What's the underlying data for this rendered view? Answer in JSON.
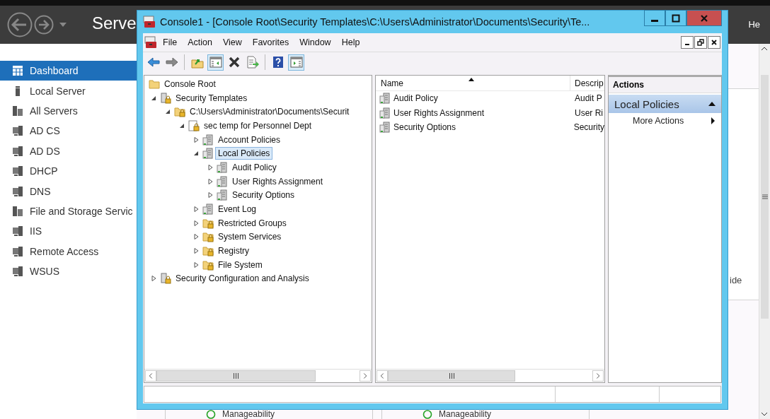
{
  "server_manager": {
    "title": "Serve",
    "user_menu": "He",
    "sidebar": [
      {
        "label": "Dashboard",
        "kind": "dashboard",
        "selected": true
      },
      {
        "label": "Local Server",
        "kind": "server",
        "selected": false
      },
      {
        "label": "All Servers",
        "kind": "servers",
        "selected": false
      },
      {
        "label": "AD CS",
        "kind": "role",
        "selected": false
      },
      {
        "label": "AD DS",
        "kind": "role",
        "selected": false
      },
      {
        "label": "DHCP",
        "kind": "role",
        "selected": false
      },
      {
        "label": "DNS",
        "kind": "role",
        "selected": false
      },
      {
        "label": "File and Storage Servic",
        "kind": "servers",
        "selected": false
      },
      {
        "label": "IIS",
        "kind": "role",
        "selected": false
      },
      {
        "label": "Remote Access",
        "kind": "role",
        "selected": false
      },
      {
        "label": "WSUS",
        "kind": "role",
        "selected": false
      }
    ],
    "panel_text": "ide",
    "tiles": [
      {
        "label": "Manageability"
      },
      {
        "label": "Manageability"
      }
    ]
  },
  "console": {
    "title": "Console1 - [Console Root\\Security Templates\\C:\\Users\\Administrator\\Documents\\Security\\Te...",
    "menu": [
      "File",
      "Action",
      "View",
      "Favorites",
      "Window",
      "Help"
    ],
    "toolbar_groups": [
      [
        {
          "kind": "back",
          "pressed": false
        },
        {
          "kind": "forward",
          "pressed": false
        }
      ],
      [
        {
          "kind": "up",
          "pressed": false
        },
        {
          "kind": "tree-toggle",
          "pressed": true
        },
        {
          "kind": "delete",
          "pressed": false
        },
        {
          "kind": "export",
          "pressed": false
        }
      ],
      [
        {
          "kind": "help",
          "pressed": false
        },
        {
          "kind": "action-pane",
          "pressed": true
        }
      ]
    ],
    "tree": [
      {
        "label": "Console Root",
        "kind": "folder",
        "selected": false,
        "children": [
          {
            "label": "Security Templates",
            "kind": "server-lock",
            "expanded": true,
            "selected": false,
            "children": [
              {
                "label": "C:\\Users\\Administrator\\Documents\\Securit",
                "kind": "folder-lock",
                "expanded": true,
                "selected": false,
                "children": [
                  {
                    "label": "sec temp for Personnel Dept",
                    "kind": "document-lock",
                    "expanded": true,
                    "selected": false,
                    "children": [
                      {
                        "label": "Account Policies",
                        "kind": "policy",
                        "expanded": false,
                        "selected": false
                      },
                      {
                        "label": "Local Policies",
                        "kind": "policy",
                        "expanded": true,
                        "selected": true,
                        "children": [
                          {
                            "label": "Audit Policy",
                            "kind": "policy",
                            "expanded": false,
                            "selected": false
                          },
                          {
                            "label": "User Rights Assignment",
                            "kind": "policy",
                            "expanded": false,
                            "selected": false
                          },
                          {
                            "label": "Security Options",
                            "kind": "policy",
                            "expanded": false,
                            "selected": false
                          }
                        ]
                      },
                      {
                        "label": "Event Log",
                        "kind": "policy",
                        "expanded": false,
                        "selected": false
                      },
                      {
                        "label": "Restricted Groups",
                        "kind": "folder-lock",
                        "expanded": false,
                        "selected": false
                      },
                      {
                        "label": "System Services",
                        "kind": "folder-lock",
                        "expanded": false,
                        "selected": false
                      },
                      {
                        "label": "Registry",
                        "kind": "folder-lock",
                        "expanded": false,
                        "selected": false
                      },
                      {
                        "label": "File System",
                        "kind": "folder-lock",
                        "expanded": false,
                        "selected": false
                      }
                    ]
                  }
                ]
              }
            ]
          },
          {
            "label": "Security Configuration and Analysis",
            "kind": "server-lock",
            "expanded": false,
            "selected": false
          }
        ]
      }
    ],
    "list": {
      "columns": [
        "Name",
        "Descrip"
      ],
      "rows": [
        {
          "name": "Audit Policy",
          "description": "Audit P"
        },
        {
          "name": "User Rights Assignment",
          "description": "User Ri"
        },
        {
          "name": "Security Options",
          "description": "Security"
        }
      ]
    },
    "actions": {
      "title": "Actions",
      "section": {
        "label": "Local Policies",
        "expanded": true
      },
      "items": [
        "More Actions"
      ]
    }
  }
}
